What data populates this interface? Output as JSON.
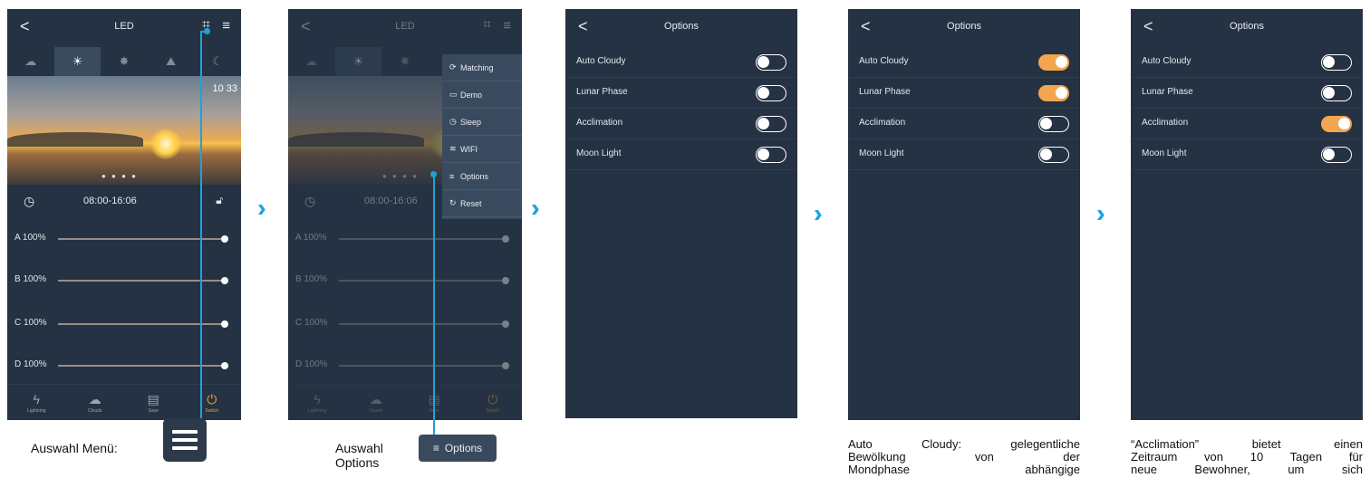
{
  "led_screen": {
    "back": "<",
    "title": "LED",
    "mode_tabs": [
      "☁",
      "☀",
      "✸",
      "⛰",
      "☾"
    ],
    "time_overlay": "10 33",
    "time_range": "08:00-16:06",
    "sliders": [
      {
        "label": "A 100%",
        "value": 100
      },
      {
        "label": "B 100%",
        "value": 100
      },
      {
        "label": "C 100%",
        "value": 100
      },
      {
        "label": "D 100%",
        "value": 100
      }
    ],
    "nav": [
      {
        "icon": "ϟ",
        "label": "Lightning"
      },
      {
        "icon": "☁",
        "label": "Clouds"
      },
      {
        "icon": "▤",
        "label": "Save"
      },
      {
        "icon": "⏻",
        "label": "Switch"
      }
    ]
  },
  "menu_screen": {
    "time_range": "08:00-16:06",
    "dropdown": [
      {
        "icon": "⟳",
        "label": "Matching"
      },
      {
        "icon": "▭",
        "label": "Demo"
      },
      {
        "icon": "◷",
        "label": "Sleep"
      },
      {
        "icon": "≋",
        "label": "WIFI"
      },
      {
        "icon": "≡",
        "label": "Options"
      },
      {
        "icon": "↻",
        "label": "Reset"
      }
    ]
  },
  "options_screens": [
    {
      "title": "Options",
      "items": [
        {
          "label": "Auto Cloudy",
          "on": false
        },
        {
          "label": "Lunar Phase",
          "on": false
        },
        {
          "label": "Acclimation",
          "on": false
        },
        {
          "label": "Moon Light",
          "on": false
        }
      ]
    },
    {
      "title": "Options",
      "items": [
        {
          "label": "Auto Cloudy",
          "on": true
        },
        {
          "label": "Lunar Phase",
          "on": true
        },
        {
          "label": "Acclimation",
          "on": false
        },
        {
          "label": "Moon Light",
          "on": false
        }
      ]
    },
    {
      "title": "Options",
      "items": [
        {
          "label": "Auto Cloudy",
          "on": false
        },
        {
          "label": "Lunar Phase",
          "on": false
        },
        {
          "label": "Acclimation",
          "on": true
        },
        {
          "label": "Moon Light",
          "on": false
        }
      ]
    }
  ],
  "captions": {
    "menu": "Auswahl Menü:",
    "options_line1": "Auswahl",
    "options_line2": "Options",
    "options_badge": "Options",
    "auto_cloudy_line1": "Auto Cloudy: gelegentliche",
    "auto_cloudy_line2": "Bewölkung von der",
    "auto_cloudy_line3": "Mondphase abhängige",
    "acclimation_line1": "“Acclimation” bietet einen",
    "acclimation_line2": "Zeitraum von 10 Tagen für",
    "acclimation_line3": "neue Bewohner, um sich"
  },
  "colors": {
    "accent": "#22a0d8",
    "toggle_on": "#f3a650",
    "screen_bg": "#253243"
  }
}
